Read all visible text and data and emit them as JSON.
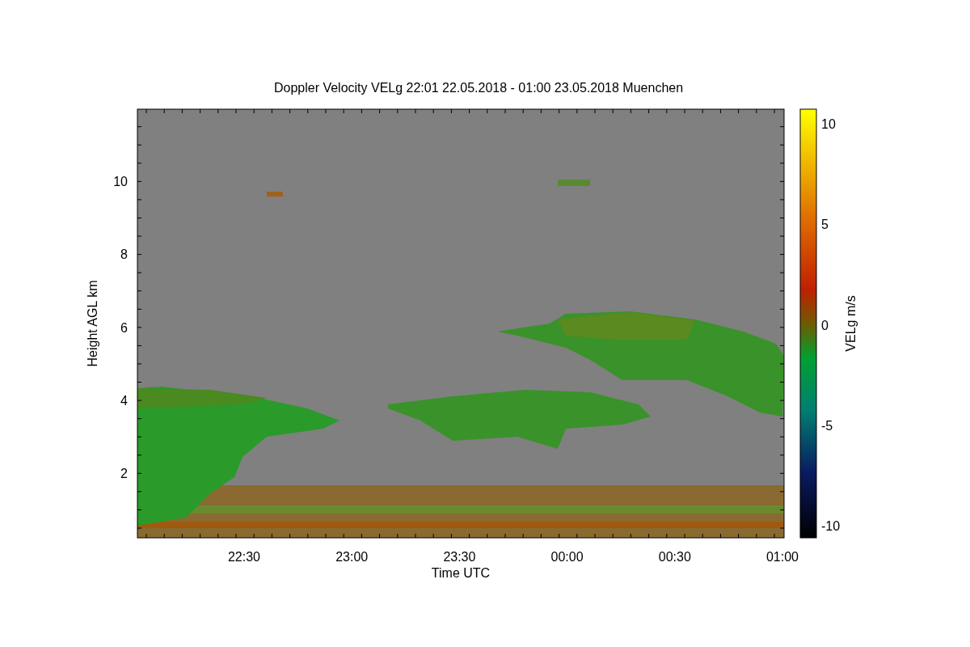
{
  "title": "Doppler Velocity VELg   22:01 22.05.2018 - 01:00 23.05.2018 Muenchen",
  "plot": {
    "y_label": "Height AGL km",
    "y_ticks": [
      "10",
      "8",
      "6",
      "4",
      "2"
    ],
    "x_label": "Time UTC",
    "x_ticks": [
      "22:30",
      "23:00",
      "23:30",
      "00:00",
      "00:30",
      "01:00"
    ]
  },
  "colorbar": {
    "label": "VELg m/s",
    "ticks": [
      "10",
      "5",
      "0",
      "-5",
      "-10"
    ]
  }
}
